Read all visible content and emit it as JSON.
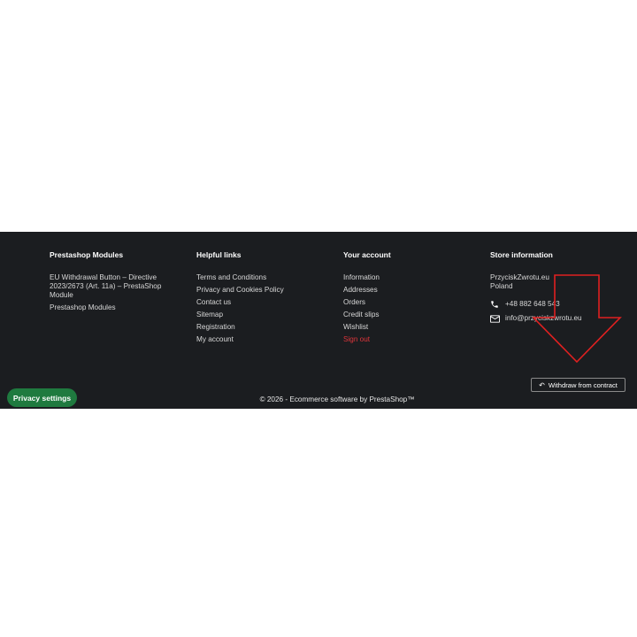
{
  "footer": {
    "columns": [
      {
        "title": "Prestashop Modules",
        "links": [
          "EU Withdrawal Button – Directive 2023/2673 (Art. 11a) – PrestaShop Module",
          "Prestashop Modules"
        ]
      },
      {
        "title": "Helpful links",
        "links": [
          "Terms and Conditions",
          "Privacy and Cookies Policy",
          "Contact us",
          "Sitemap",
          "Registration",
          "My account"
        ]
      },
      {
        "title": "Your account",
        "links": [
          "Information",
          "Addresses",
          "Orders",
          "Credit slips",
          "Wishlist",
          "Sign out"
        ]
      }
    ],
    "store": {
      "title": "Store information",
      "name": "PrzyciskZwrotu.eu",
      "country": "Poland",
      "phone": "+48 882 648 543",
      "email": "info@przyciskzwrotu.eu"
    },
    "copyright": "© 2026 - Ecommerce software by PrestaShop™"
  },
  "buttons": {
    "privacy": "Privacy settings",
    "withdraw": "Withdraw from contract"
  },
  "colors": {
    "footer_bg": "#1b1d20",
    "privacy_green": "#1f7a3f",
    "signout_red": "#e0353b",
    "annotation_arrow": "#e02020"
  },
  "icons": {
    "phone": "phone-icon",
    "email": "envelope-icon",
    "withdraw": "undo-arrow-icon"
  }
}
